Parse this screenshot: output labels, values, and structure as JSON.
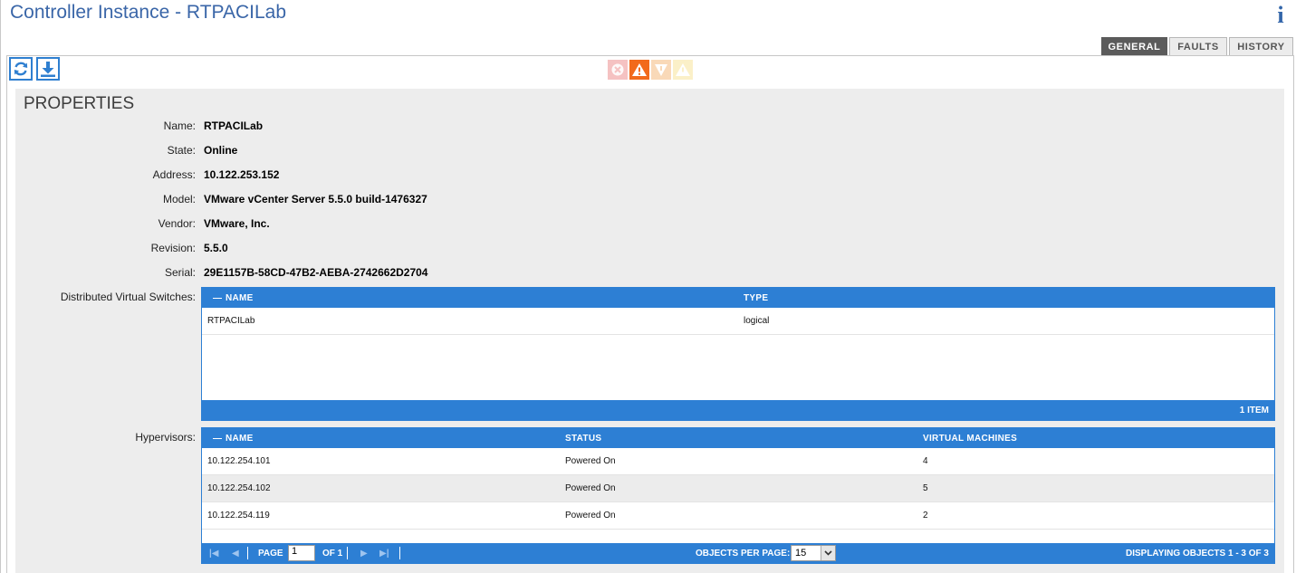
{
  "header": {
    "title": "Controller Instance - RTPACILab",
    "info_icon": "info-icon",
    "info_glyph": "i"
  },
  "tabs": [
    {
      "label": "GENERAL",
      "active": true
    },
    {
      "label": "FAULTS",
      "active": false
    },
    {
      "label": "HISTORY",
      "active": false
    }
  ],
  "toolbar": {
    "refresh_icon": "refresh-icon",
    "download_icon": "download-icon"
  },
  "fault_icons": [
    {
      "name": "critical-fault-icon",
      "color": "#f5c2c2"
    },
    {
      "name": "major-fault-icon",
      "color": "#f26a1b"
    },
    {
      "name": "minor-fault-icon",
      "color": "#f9d9b8"
    },
    {
      "name": "warning-fault-icon",
      "color": "#fbf0c8"
    }
  ],
  "properties": {
    "title": "PROPERTIES",
    "fields": [
      {
        "label": "Name:",
        "value": "RTPACILab"
      },
      {
        "label": "State:",
        "value": "Online"
      },
      {
        "label": "Address:",
        "value": "10.122.253.152"
      },
      {
        "label": "Model:",
        "value": "VMware vCenter Server 5.5.0 build-1476327"
      },
      {
        "label": "Vendor:",
        "value": "VMware, Inc."
      },
      {
        "label": "Revision:",
        "value": "5.5.0"
      },
      {
        "label": "Serial:",
        "value": "29E1157B-58CD-47B2-AEBA-2742662D2704"
      }
    ],
    "dvs": {
      "label": "Distributed Virtual Switches:",
      "columns": [
        "NAME",
        "TYPE"
      ],
      "rows": [
        [
          "RTPACILab",
          "logical"
        ]
      ],
      "footer": "1 ITEM"
    },
    "hypervisors": {
      "label": "Hypervisors:",
      "columns": [
        "NAME",
        "STATUS",
        "VIRTUAL MACHINES"
      ],
      "rows": [
        [
          "10.122.254.101",
          "Powered On",
          "4"
        ],
        [
          "10.122.254.102",
          "Powered On",
          "5"
        ],
        [
          "10.122.254.119",
          "Powered On",
          "2"
        ]
      ],
      "pager": {
        "page_label": "PAGE",
        "page_value": "1",
        "of_label": "OF 1",
        "per_page_label": "OBJECTS PER PAGE:",
        "per_page_value": "15",
        "displaying": "DISPLAYING OBJECTS 1 - 3 OF 3"
      }
    }
  },
  "colors": {
    "accent": "#2d7fd4",
    "title": "#3a66a8",
    "panel_bg": "#ededed"
  }
}
